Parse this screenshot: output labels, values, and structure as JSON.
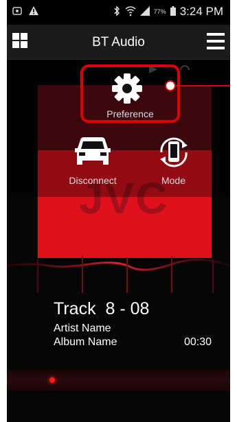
{
  "status_bar": {
    "battery_pct": "77%",
    "time": "3:24 PM"
  },
  "app_bar": {
    "title": "BT Audio"
  },
  "popup_menu": {
    "preference_label": "Preference",
    "disconnect_label": "Disconnect",
    "mode_label": "Mode"
  },
  "album_art": {
    "logo_text": "JVC"
  },
  "track": {
    "title": "Track  8 - 08",
    "artist": "Artist Name",
    "album": "Album Name",
    "elapsed": "00:30"
  },
  "colors": {
    "accent": "#e00000",
    "album_red": "#e0101c"
  }
}
